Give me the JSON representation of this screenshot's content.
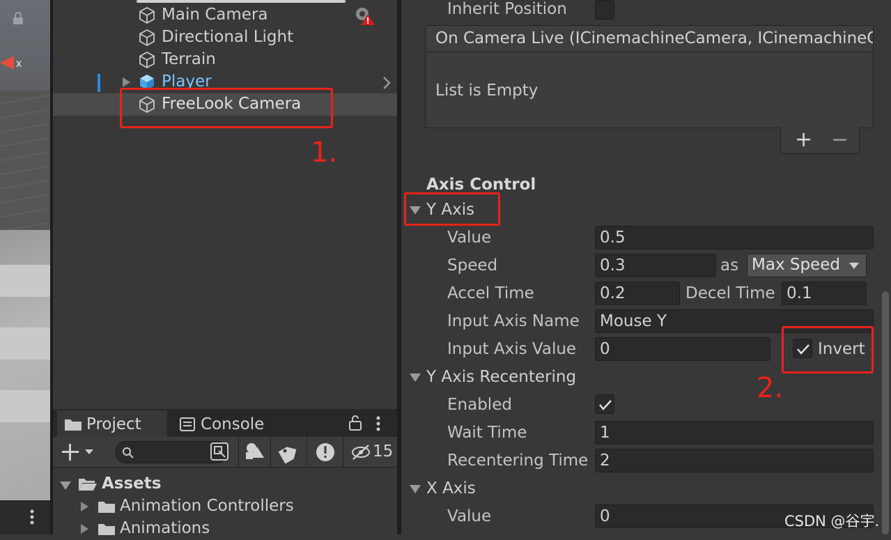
{
  "hierarchy": {
    "items": [
      {
        "label": "Main Camera"
      },
      {
        "label": "Directional Light"
      },
      {
        "label": "Terrain"
      },
      {
        "label": "Player"
      },
      {
        "label": "FreeLook Camera"
      }
    ],
    "annotation": "1."
  },
  "project_panel": {
    "tabs": [
      "Project",
      "Console"
    ],
    "hidden_count": "15",
    "tree": [
      {
        "label": "Assets"
      },
      {
        "label": "Animation Controllers"
      },
      {
        "label": "Animations"
      }
    ]
  },
  "inspector": {
    "inherit_position_label": "Inherit Position",
    "event_header": "On Camera Live (ICinemachineCamera, ICinemachineC",
    "list_empty": "List is Empty",
    "plus": "+",
    "minus": "−",
    "section": "Axis Control",
    "y_axis": {
      "title": "Y Axis",
      "value_label": "Value",
      "value": "0.5",
      "speed_label": "Speed",
      "speed": "0.3",
      "as_label": "as",
      "speed_mode": "Max Speed",
      "accel_label": "Accel Time",
      "accel": "0.2",
      "decel_label": "Decel Time",
      "decel": "0.1",
      "input_name_label": "Input Axis Name",
      "input_name": "Mouse Y",
      "input_value_label": "Input Axis Value",
      "input_value": "0",
      "invert_label": "Invert"
    },
    "recentering": {
      "title": "Y Axis Recentering",
      "enabled_label": "Enabled",
      "wait_label": "Wait Time",
      "wait": "1",
      "recenter_label": "Recentering Time",
      "recenter": "2"
    },
    "x_axis": {
      "title": "X Axis",
      "value_label": "Value",
      "value": "0"
    },
    "annotation": "2."
  },
  "watermark": "CSDN @谷宇.",
  "colors": {
    "highlight": "#e8221c",
    "player_blue": "#7cc3ff",
    "selection": "#4b4b4b"
  }
}
